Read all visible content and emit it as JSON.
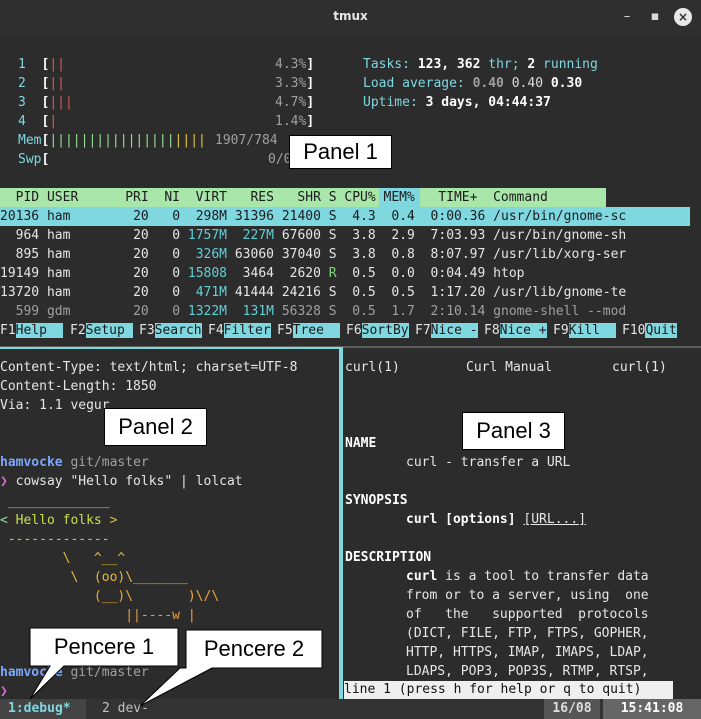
{
  "window": {
    "title": "tmux",
    "minimize": "–",
    "maximize": "▪",
    "close": "×"
  },
  "htop": {
    "cpu_bars": [
      {
        "num": "1",
        "bar": "||",
        "pct": "4.3%"
      },
      {
        "num": "2",
        "bar": "||",
        "pct": "3.3%"
      },
      {
        "num": "3",
        "bar": "|||",
        "pct": "4.7%"
      },
      {
        "num": "4",
        "bar": "|",
        "pct": "1.4%"
      }
    ],
    "mem_label": "Mem",
    "mem_bar": "||||||||||||||||",
    "mem_value": "1907/784",
    "swp_label": "Swp",
    "swp_value": "0/0",
    "tasks_label": "Tasks: ",
    "tasks_value": "123, 362",
    "thr_label": " thr; ",
    "running_value": "2",
    "running_label": " running",
    "load_label": "Load average: ",
    "load_1": "0.40",
    "load_5": "0.40",
    "load_15": "0.30",
    "uptime_label": "Uptime: ",
    "uptime_value": "3 days, 04:44:37",
    "header": "  PID USER      PRI  NI  VIRT   RES   SHR S CPU% MEM%   TIME+  Command",
    "rows": [
      {
        "pid": "20136",
        "user": "ham",
        "pri": "20",
        "ni": "0",
        "virt": "298M",
        "res": "31396",
        "shr": "21400",
        "s": "S",
        "cpu": "4.3",
        "mem": "0.4",
        "time": "0:00.36",
        "cmd": "/usr/bin/gnome-sc"
      },
      {
        "pid": "964",
        "user": "ham",
        "pri": "20",
        "ni": "0",
        "virt": "1757M",
        "res": "227M",
        "shr": "67600",
        "s": "S",
        "cpu": "3.8",
        "mem": "2.9",
        "time": "7:03.93",
        "cmd": "/usr/bin/gnome-sh"
      },
      {
        "pid": "895",
        "user": "ham",
        "pri": "20",
        "ni": "0",
        "virt": "326M",
        "res": "63060",
        "shr": "37040",
        "s": "S",
        "cpu": "3.8",
        "mem": "0.8",
        "time": "8:07.97",
        "cmd": "/usr/lib/xorg-ser"
      },
      {
        "pid": "19149",
        "user": "ham",
        "pri": "20",
        "ni": "0",
        "virt": "15808",
        "res": "3464",
        "shr": "2620",
        "s": "R",
        "cpu": "0.5",
        "mem": "0.0",
        "time": "0:04.49",
        "cmd": "htop"
      },
      {
        "pid": "13720",
        "user": "ham",
        "pri": "20",
        "ni": "0",
        "virt": "471M",
        "res": "41444",
        "shr": "24216",
        "s": "S",
        "cpu": "0.5",
        "mem": "0.5",
        "time": "1:17.20",
        "cmd": "/usr/lib/gnome-te"
      },
      {
        "pid": "599",
        "user": "gdm",
        "pri": "20",
        "ni": "0",
        "virt": "1322M",
        "res": "131M",
        "shr": "56328",
        "s": "S",
        "cpu": "0.5",
        "mem": "1.7",
        "time": "2:10.14",
        "cmd": "gnome-shell --mod"
      }
    ],
    "fkeys": [
      {
        "key": "F1",
        "label": "Help  "
      },
      {
        "key": "F2",
        "label": "Setup "
      },
      {
        "key": "F3",
        "label": "Search"
      },
      {
        "key": "F4",
        "label": "Filter"
      },
      {
        "key": "F5",
        "label": "Tree  "
      },
      {
        "key": "F6",
        "label": "SortBy"
      },
      {
        "key": "F7",
        "label": "Nice -"
      },
      {
        "key": "F8",
        "label": "Nice +"
      },
      {
        "key": "F9",
        "label": "Kill  "
      },
      {
        "key": "F10",
        "label": "Quit"
      }
    ]
  },
  "left_pane": {
    "line1": "Content-Type: text/html; charset=UTF-8",
    "line2": "Content-Length: 1850",
    "line3": "Via: 1.1 vegur",
    "prompt_user": "hamvocke",
    "prompt_branch": " git/master",
    "prompt_symbol": "❯",
    "command": " cowsay \"Hello folks\" | lolcat",
    "cow_top": " _____________",
    "cow_msg_open": "< ",
    "cow_msg": "Hello folks",
    "cow_msg_close": " >",
    "cow_bottom": " -------------",
    "cow1": "        \\   ^__^",
    "cow2": "         \\  (oo)\\_______",
    "cow3": "            (__)\\       )\\/\\",
    "cow4": "                ||----w |",
    "prompt2_user": "hamvocke",
    "prompt2_branch": " git/master",
    "prompt2_symbol": "❯"
  },
  "right_pane": {
    "head_left": "curl(1)",
    "head_center": "Curl Manual",
    "head_right": "curl(1)",
    "name_h": "NAME",
    "name_text": "curl - transfer a URL",
    "synopsis_h": "SYNOPSIS",
    "synopsis_cmd": "curl [options]",
    "synopsis_url": "[URL...]",
    "description_h": "DESCRIPTION",
    "desc_first": "curl",
    "desc1": " is a tool to transfer data",
    "desc2": "from or to a server, using  one",
    "desc3": "of   the   supported  protocols",
    "desc4": "(DICT, FILE, FTP, FTPS, GOPHER,",
    "desc5": "HTTP, HTTPS, IMAP, IMAPS, LDAP,",
    "desc6": "LDAPS, POP3, POP3S, RTMP, RTSP,",
    "pager_line": "line 1 (press h for help or q to quit)"
  },
  "statusbar": {
    "window1": "1:debug*",
    "window2": "2 dev-",
    "date": "16/08",
    "time": "15:41:08"
  },
  "callouts": {
    "panel1": "Panel 1",
    "panel2": "Panel 2",
    "panel3": "Panel 3",
    "pencere1": "Pencere 1",
    "pencere2": "Pencere 2"
  }
}
